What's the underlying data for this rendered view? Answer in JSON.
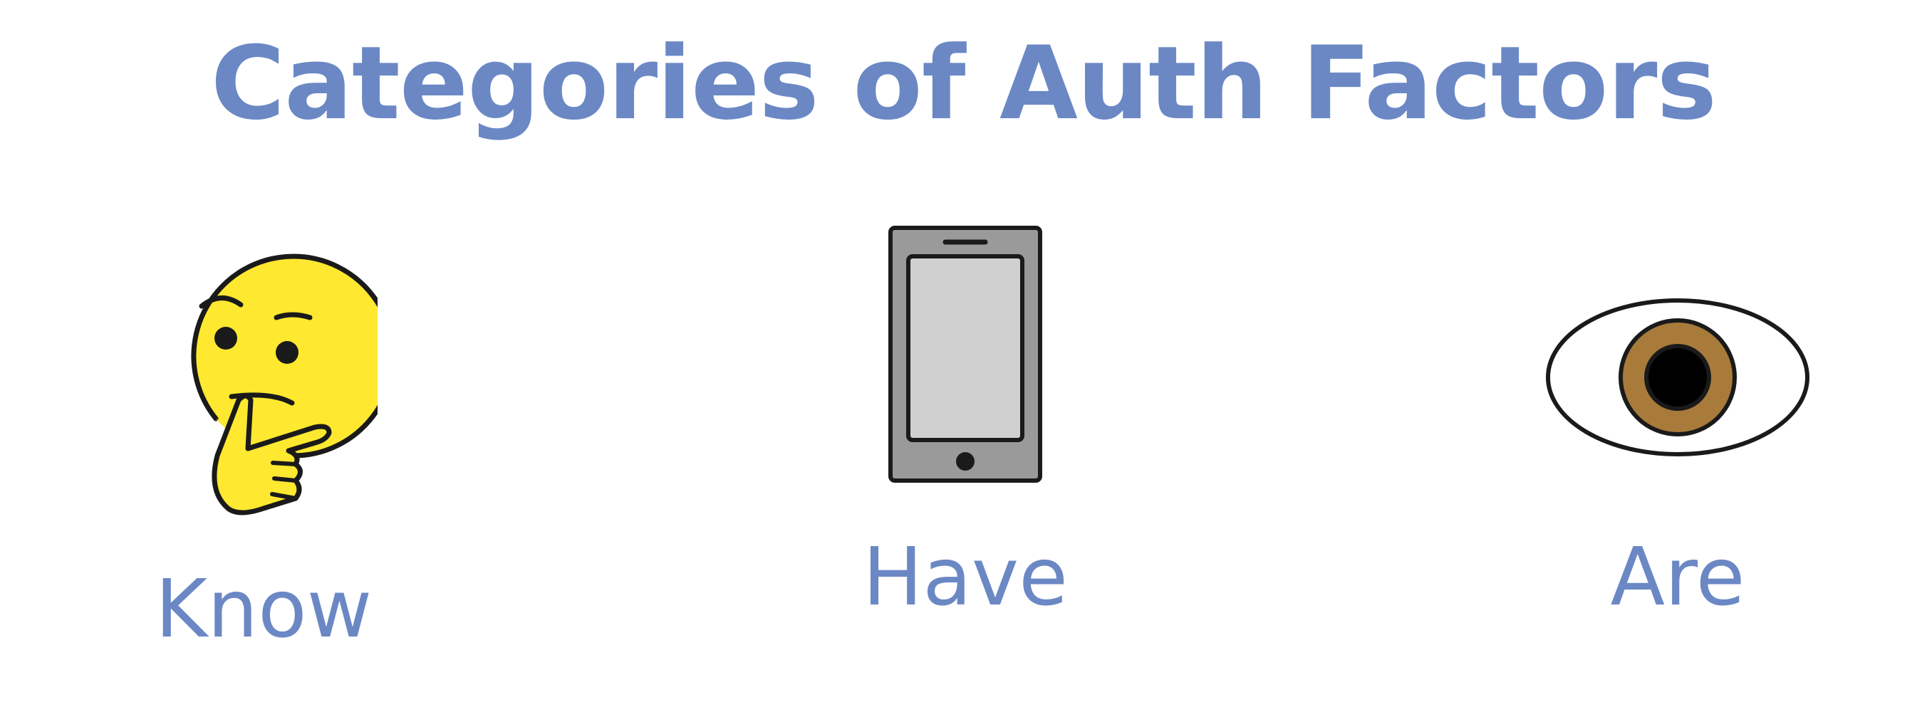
{
  "title": "Categories of Auth Factors",
  "colors": {
    "accent": "#6b88c5",
    "emoji_yellow": "#ffe830",
    "phone_body": "#9a9a9a",
    "phone_screen": "#d0d0d0",
    "iris": "#a87b3a",
    "outline": "#1a1a1a"
  },
  "factors": [
    {
      "label": "Know",
      "icon": "thinking-face-icon"
    },
    {
      "label": "Have",
      "icon": "smartphone-icon"
    },
    {
      "label": "Are",
      "icon": "eye-icon"
    }
  ]
}
